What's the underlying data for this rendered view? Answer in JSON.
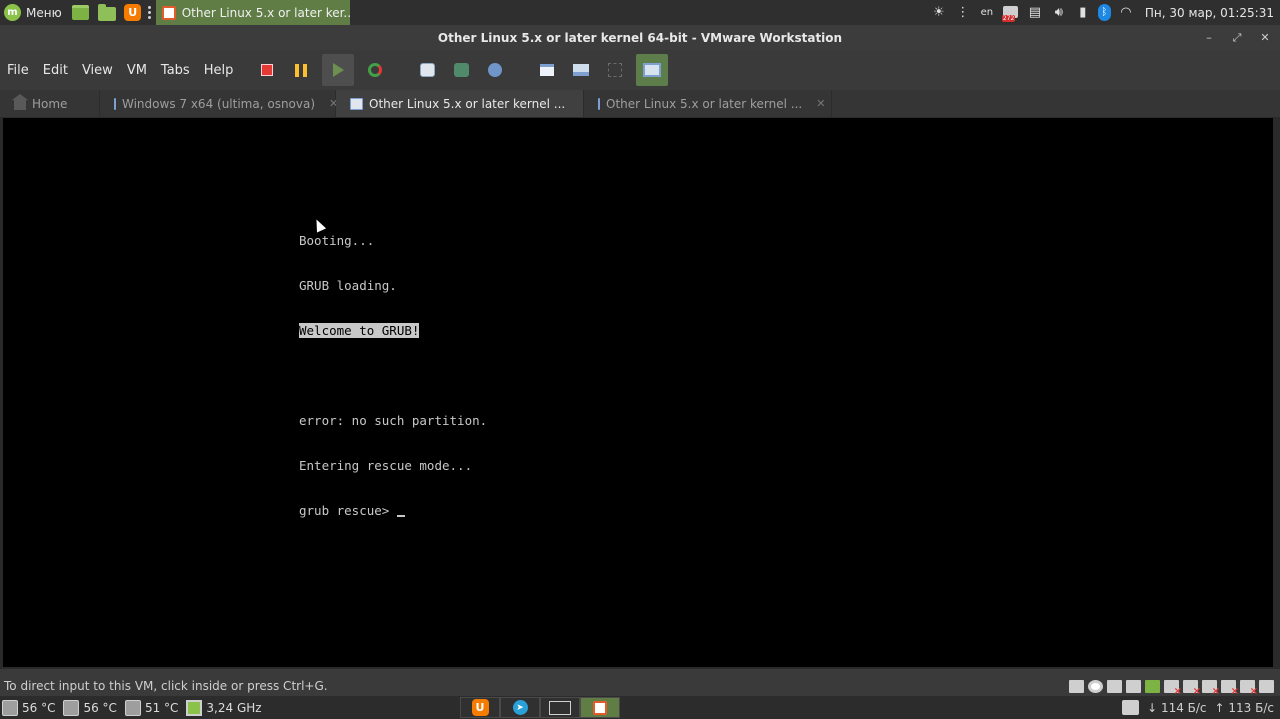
{
  "top_panel": {
    "menu_label": "Меню",
    "window_title": "Other Linux 5.x or later ker...",
    "language": "en",
    "update_badge": "272",
    "clock": "Пн, 30 мар, 01:25:31",
    "launchers": [
      "terminal-icon",
      "files-icon",
      "ubuntu-software-icon"
    ]
  },
  "window": {
    "title": "Other Linux 5.x or later kernel 64-bit - VMware Workstation",
    "minimize": "–",
    "maximize": "⤢",
    "close": "✕"
  },
  "menubar": [
    "File",
    "Edit",
    "View",
    "VM",
    "Tabs",
    "Help"
  ],
  "tabs": [
    {
      "label": "Home",
      "icon": "home-icon"
    },
    {
      "label": "Windows 7 x64 (ultima, osnova)",
      "icon": "vm-icon"
    },
    {
      "label": "Other Linux 5.x or later kernel ...",
      "icon": "vm-icon"
    },
    {
      "label": "Other Linux 5.x or later kernel ...",
      "icon": "vm-icon"
    }
  ],
  "console": {
    "lines": [
      "Booting...",
      "GRUB loading.",
      "Welcome to GRUB!",
      "",
      "error: no such partition.",
      "Entering rescue mode...",
      "grub rescue> "
    ]
  },
  "statusbar": {
    "message": "To direct input to this VM, click inside or press Ctrl+G."
  },
  "bottom_panel": {
    "temp1": "56 °C",
    "temp2": "56 °C",
    "temp3": "51 °C",
    "cpu_freq": "3,24 GHz",
    "net_down": "114 Б/с",
    "net_up": "113 Б/с"
  }
}
